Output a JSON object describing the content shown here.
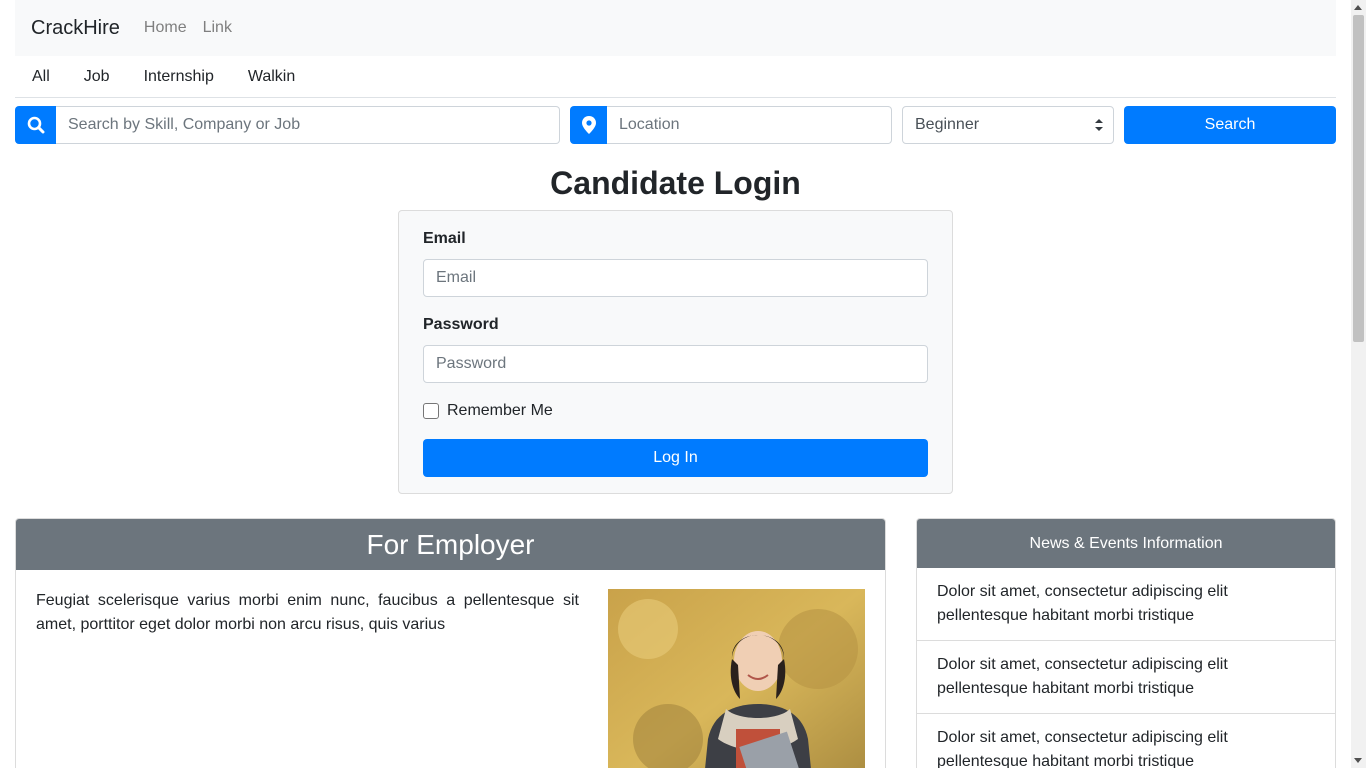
{
  "navbar": {
    "brand": "CrackHire",
    "links": [
      "Home",
      "Link"
    ]
  },
  "categories": [
    "All",
    "Job",
    "Internship",
    "Walkin"
  ],
  "search": {
    "keyword_placeholder": "Search by Skill, Company or Job",
    "location_placeholder": "Location",
    "level_selected": "Beginner",
    "button_label": "Search"
  },
  "login": {
    "title": "Candidate Login",
    "email_label": "Email",
    "email_placeholder": "Email",
    "password_label": "Password",
    "password_placeholder": "Password",
    "remember_label": "Remember Me",
    "button_label": "Log In"
  },
  "employer": {
    "title": "For Employer",
    "text": "Feugiat scelerisque varius morbi enim nunc, faucibus a pellentesque sit amet, porttitor eget dolor morbi non arcu risus, quis varius"
  },
  "news": {
    "title": "News & Events Information",
    "items": [
      "Dolor sit amet, consectetur adipiscing elit pellentesque habitant morbi tristique",
      "Dolor sit amet, consectetur adipiscing elit pellentesque habitant morbi tristique",
      "Dolor sit amet, consectetur adipiscing elit pellentesque habitant morbi tristique"
    ]
  },
  "colors": {
    "primary": "#007bff",
    "card_header": "#6c757d",
    "navbar_bg": "#f8f9fa"
  },
  "icons": {
    "search": "search-icon",
    "location": "map-marker-icon",
    "select_caret": "select-caret-icon"
  }
}
